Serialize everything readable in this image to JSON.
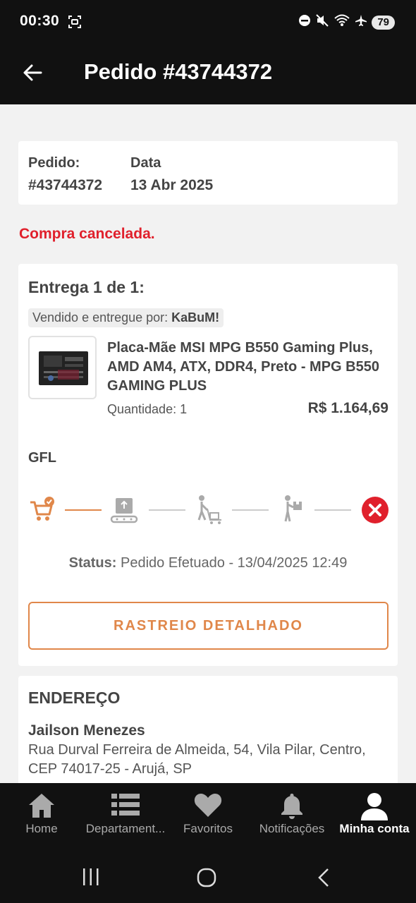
{
  "status_bar": {
    "time": "00:30",
    "battery": "79",
    "icons": [
      "screenshot-icon",
      "do-not-disturb-icon",
      "mute-icon",
      "wifi-icon",
      "airplane-icon"
    ]
  },
  "app_bar": {
    "title": "Pedido #43744372",
    "back_icon": "arrow-left-icon"
  },
  "order_summary": {
    "order_label": "Pedido:",
    "order_value": "#43744372",
    "date_label": "Data",
    "date_value": "13 Abr 2025"
  },
  "cancel_notice": "Compra cancelada.",
  "delivery": {
    "title": "Entrega 1 de 1:",
    "seller_prefix": "Vendido e entregue por:",
    "seller_name": "KaBuM!",
    "product_name": "Placa-Mãe MSI MPG B550 Gaming Plus, AMD AM4, ATX, DDR4, Preto - MPG B550 GAMING PLUS",
    "quantity": "Quantidade: 1",
    "price": "R$ 1.164,69",
    "carrier": "GFL",
    "tracking_steps": [
      "cart-check-icon",
      "package-conveyor-icon",
      "person-cart-icon",
      "person-package-icon",
      "cancel-x-icon"
    ],
    "status_label": "Status:",
    "status_value": "Pedido Efetuado - 13/04/2025 12:49",
    "tracking_button": "RASTREIO DETALHADO"
  },
  "address": {
    "title": "ENDEREÇO",
    "name": "Jailson Menezes",
    "line": "Rua Durval Ferreira de Almeida, 54, Vila Pilar, Centro, CEP 74017-25 - Arujá, SP"
  },
  "bottom_nav": [
    {
      "label": "Home",
      "icon": "home-icon"
    },
    {
      "label": "Departament...",
      "icon": "list-icon"
    },
    {
      "label": "Favoritos",
      "icon": "heart-icon"
    },
    {
      "label": "Notificações",
      "icon": "bell-icon"
    },
    {
      "label": "Minha conta",
      "icon": "user-icon",
      "active": true
    }
  ],
  "colors": {
    "accent": "#e0874a",
    "cancel": "#e0202c",
    "dark_bar": "#111111"
  }
}
